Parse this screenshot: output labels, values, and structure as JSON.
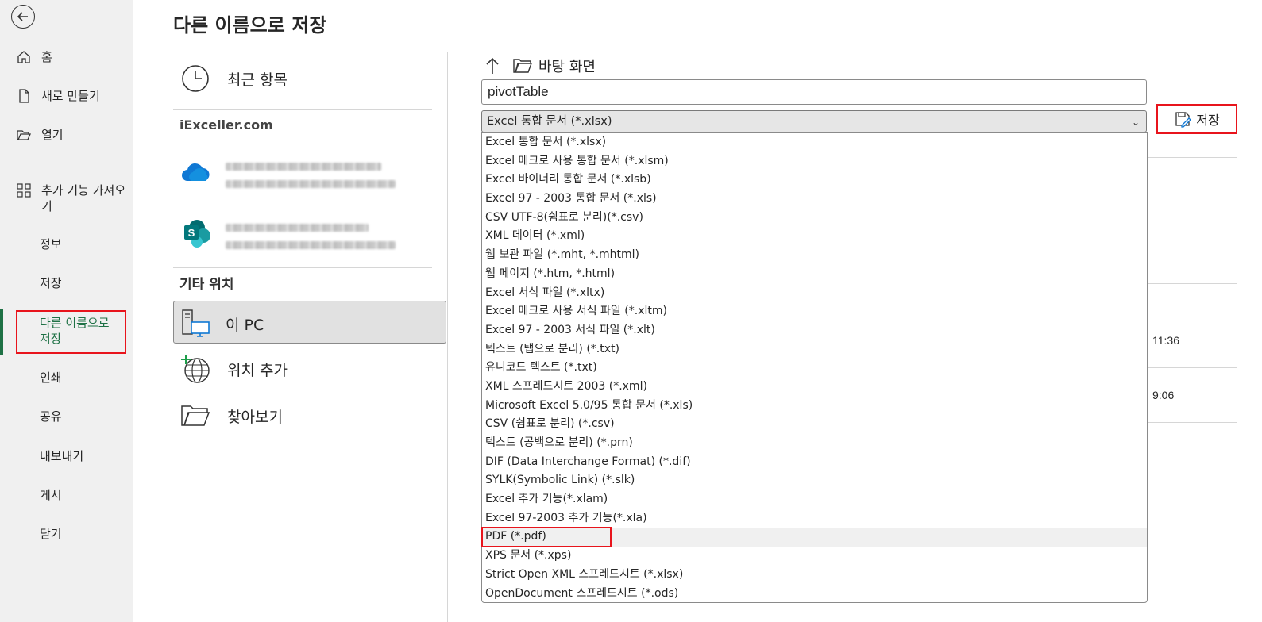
{
  "nav": {
    "home": "홈",
    "new": "새로 만들기",
    "open": "열기",
    "addins": "추가 기능 가져오기",
    "info": "정보",
    "save": "저장",
    "save_as": "다른 이름으로 저장",
    "print": "인쇄",
    "share": "공유",
    "export": "내보내기",
    "publish": "게시",
    "close": "닫기"
  },
  "page": {
    "title": "다른 이름으로 저장"
  },
  "locations": {
    "recent": "최근 항목",
    "org": "iExceller.com",
    "other_header": "기타 위치",
    "this_pc": "이 PC",
    "add_place": "위치 추가",
    "browse": "찾아보기"
  },
  "path": {
    "folder": "바탕 화면"
  },
  "file": {
    "name": "pivotTable"
  },
  "file_type": {
    "selected": "Excel 통합 문서 (*.xlsx)",
    "options": [
      "Excel 통합 문서 (*.xlsx)",
      "Excel 매크로 사용 통합 문서 (*.xlsm)",
      "Excel 바이너리 통합 문서 (*.xlsb)",
      "Excel 97 - 2003 통합 문서 (*.xls)",
      "CSV UTF-8(쉼표로 분리)(*.csv)",
      "XML 데이터 (*.xml)",
      "웹 보관 파일 (*.mht, *.mhtml)",
      "웹 페이지 (*.htm, *.html)",
      "Excel 서식 파일 (*.xltx)",
      "Excel 매크로 사용 서식 파일 (*.xltm)",
      "Excel 97 - 2003 서식 파일 (*.xlt)",
      "텍스트 (탭으로 분리) (*.txt)",
      "유니코드 텍스트 (*.txt)",
      "XML 스프레드시트 2003 (*.xml)",
      "Microsoft Excel 5.0/95 통합 문서 (*.xls)",
      "CSV (쉼표로 분리) (*.csv)",
      "텍스트 (공백으로 분리) (*.prn)",
      "DIF (Data Interchange Format) (*.dif)",
      "SYLK(Symbolic Link) (*.slk)",
      "Excel 추가 기능(*.xlam)",
      "Excel 97-2003 추가 기능(*.xla)",
      "PDF (*.pdf)",
      "XPS 문서 (*.xps)",
      "Strict Open XML 스프레드시트 (*.xlsx)",
      "OpenDocument 스프레드시트 (*.ods)"
    ],
    "highlighted_index": 21
  },
  "save_button": {
    "label": "저장"
  },
  "recent_times": [
    "11:36",
    "9:06"
  ],
  "colors": {
    "accent": "#1e7145",
    "highlight_box": "#e8141c",
    "nav_bg": "#f0f0f0"
  }
}
